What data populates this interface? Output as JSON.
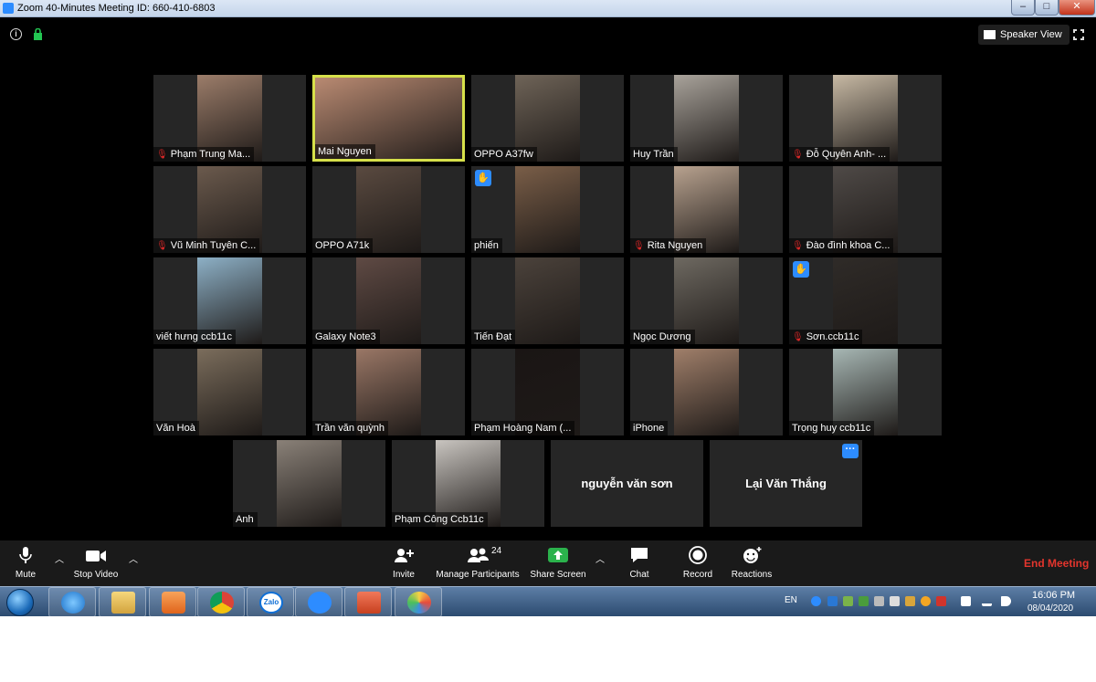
{
  "window": {
    "title": "Zoom 40-Minutes Meeting ID: 660-410-6803",
    "controls": [
      "minimize",
      "maximize",
      "close"
    ]
  },
  "meeting": {
    "info_icon": "info-icon",
    "lock_icon": "lock-icon",
    "view_button_label": "Speaker View",
    "participants": [
      {
        "name": "Phạm Trung Ma...",
        "muted": true,
        "video_color": "#9c7d6a"
      },
      {
        "name": "Mai Nguyen",
        "muted": false,
        "active_speaker": true,
        "video_color": "#b98a72"
      },
      {
        "name": "OPPO A37fw",
        "muted": false,
        "video_color": "#6f6458"
      },
      {
        "name": "Huy Trần",
        "muted": false,
        "video_color": "#a9a39b"
      },
      {
        "name": "Đỗ Quyên Anh- ...",
        "muted": true,
        "video_color": "#c7b9a4"
      },
      {
        "name": "Vũ Minh Tuyên C...",
        "muted": true,
        "video_color": "#6b5a4d"
      },
      {
        "name": "OPPO A71k",
        "muted": false,
        "video_color": "#5a4a40"
      },
      {
        "name": "phiến",
        "muted": false,
        "raised_hand": true,
        "video_color": "#7a5e48"
      },
      {
        "name": "Rita Nguyen",
        "muted": true,
        "video_color": "#b8a28f"
      },
      {
        "name": "Đào đình khoa C...",
        "muted": true,
        "video_color": "#4f4a47"
      },
      {
        "name": "viết hưng ccb11c",
        "muted": false,
        "video_color": "#8db0c6"
      },
      {
        "name": "Galaxy Note3",
        "muted": false,
        "video_color": "#5f4a44"
      },
      {
        "name": "Tiến Đạt",
        "muted": false,
        "video_color": "#4b423b"
      },
      {
        "name": "Ngọc Dương",
        "muted": false,
        "video_color": "#6e6961"
      },
      {
        "name": "Sơn.ccb11c",
        "muted": true,
        "raised_hand": true,
        "video_color": "#2f2b28"
      },
      {
        "name": "Văn Hoà",
        "muted": false,
        "video_color": "#7b6d5c"
      },
      {
        "name": "Trần văn quỳnh",
        "muted": false,
        "video_color": "#9a7766"
      },
      {
        "name": "Phạm Hoàng Nam (...",
        "muted": false,
        "video_color": "#1a1514"
      },
      {
        "name": "iPhone",
        "muted": false,
        "video_color": "#a07f6a"
      },
      {
        "name": "Trọng huy ccb11c",
        "muted": false,
        "video_color": "#a7b7b4"
      },
      {
        "name": "Anh",
        "muted": false,
        "video_color": "#8a8178"
      },
      {
        "name": "Phạm Công Ccb11c",
        "muted": false,
        "video_color": "#c9c5c0"
      },
      {
        "name": "nguyễn văn sơn",
        "muted": false,
        "no_video": true
      },
      {
        "name": "Lại Văn Thắng",
        "muted": false,
        "no_video": true,
        "more_button": true
      }
    ]
  },
  "controls": {
    "mute_label": "Mute",
    "stop_video_label": "Stop Video",
    "invite_label": "Invite",
    "manage_participants_label": "Manage Participants",
    "participant_count": "24",
    "share_screen_label": "Share Screen",
    "chat_label": "Chat",
    "record_label": "Record",
    "reactions_label": "Reactions",
    "end_meeting_label": "End Meeting",
    "colors": {
      "share_green": "#2bb24c",
      "end_red": "#e3352d",
      "accent_blue": "#2d8cff"
    }
  },
  "taskbar": {
    "apps": [
      "internet-explorer-icon",
      "file-explorer-icon",
      "media-player-icon",
      "chrome-icon",
      "zalo-icon",
      "zoom-icon",
      "powerpoint-icon",
      "paint-icon"
    ],
    "zalo_label": "Zalo",
    "language": "EN",
    "time": "16:06 PM",
    "date": "08/04/2020"
  }
}
